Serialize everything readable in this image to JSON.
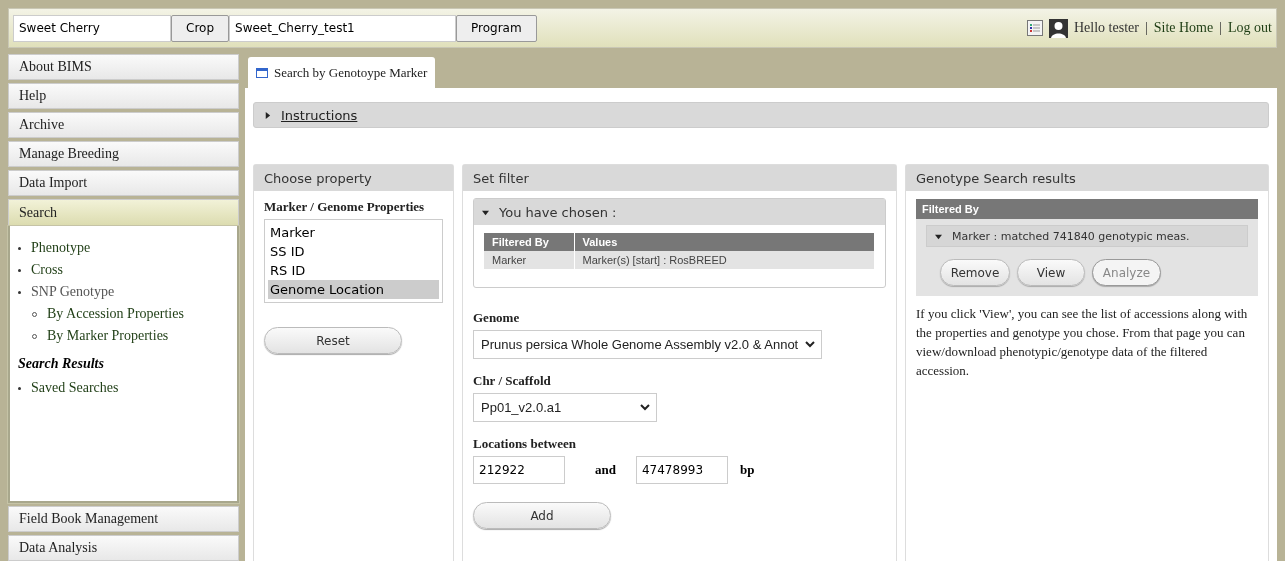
{
  "top_bar": {
    "crop_value": "Sweet Cherry",
    "crop_button": "Crop",
    "program_value": "Sweet_Cherry_test1",
    "program_button": "Program",
    "greeting": "Hello tester",
    "separator_1": "|",
    "site_home": "Site Home",
    "separator_2": "|",
    "log_out": "Log out"
  },
  "sidebar": {
    "items": [
      {
        "label": "About BIMS",
        "expanded": false
      },
      {
        "label": "Help",
        "expanded": false
      },
      {
        "label": "Archive",
        "expanded": false
      },
      {
        "label": "Manage Breeding",
        "expanded": false
      },
      {
        "label": "Data Import",
        "expanded": false
      },
      {
        "label": "Search",
        "expanded": true,
        "sections": [
          {
            "items": [
              {
                "label": "Phenotype",
                "link": true
              },
              {
                "label": "Cross",
                "link": true
              },
              {
                "label": "SNP Genotype",
                "link": false,
                "children": [
                  {
                    "label": "By Accession Properties",
                    "link": true
                  },
                  {
                    "label": "By Marker Properties",
                    "link": true
                  }
                ]
              }
            ]
          },
          {
            "heading": "Search Results",
            "items": [
              {
                "label": "Saved Searches",
                "link": true
              }
            ]
          }
        ]
      },
      {
        "label": "Field Book Management",
        "expanded": false
      },
      {
        "label": "Data Analysis",
        "expanded": false
      }
    ]
  },
  "tabs": [
    {
      "label": "Search by Genotoype Marker",
      "selected": true
    }
  ],
  "instructions": {
    "label": "Instructions",
    "expanded": false
  },
  "choose_property": {
    "title": "Choose property",
    "list_label": "Marker / Genome Properties",
    "options": [
      {
        "label": "Marker",
        "selected": false
      },
      {
        "label": "SS ID",
        "selected": false
      },
      {
        "label": "RS ID",
        "selected": false
      },
      {
        "label": "Genome Location",
        "selected": true
      }
    ],
    "reset_button": "Reset"
  },
  "set_filter": {
    "title": "Set filter",
    "chosen": {
      "title": "You have chosen :",
      "expanded": true,
      "columns": [
        "Filtered By",
        "Values"
      ],
      "rows": [
        [
          "Marker",
          "Marker(s) [start] : RosBREED"
        ]
      ]
    },
    "genome": {
      "label": "Genome",
      "value": "Prunus persica Whole Genome Assembly v2.0 & Annot"
    },
    "chr": {
      "label": "Chr / Scaffold",
      "value": "Pp01_v2.0.a1"
    },
    "locations": {
      "label": "Locations between",
      "from": "212922",
      "and": "and",
      "to": "47478993",
      "unit": "bp"
    },
    "add_button": "Add"
  },
  "results": {
    "title": "Genotype Search results",
    "header": "Filtered By",
    "filters": [
      {
        "label": "Marker : matched 741840 genotypic meas.",
        "expanded": true
      }
    ],
    "buttons": [
      {
        "label": "Remove",
        "disabled": false
      },
      {
        "label": "View",
        "disabled": false
      },
      {
        "label": "Analyze",
        "disabled": true
      }
    ],
    "note": "If you click 'View', you can see the list of accessions along with the properties and genotype you chose. From that page you can view/download phenotypic/genotype data of the filtered accession."
  }
}
